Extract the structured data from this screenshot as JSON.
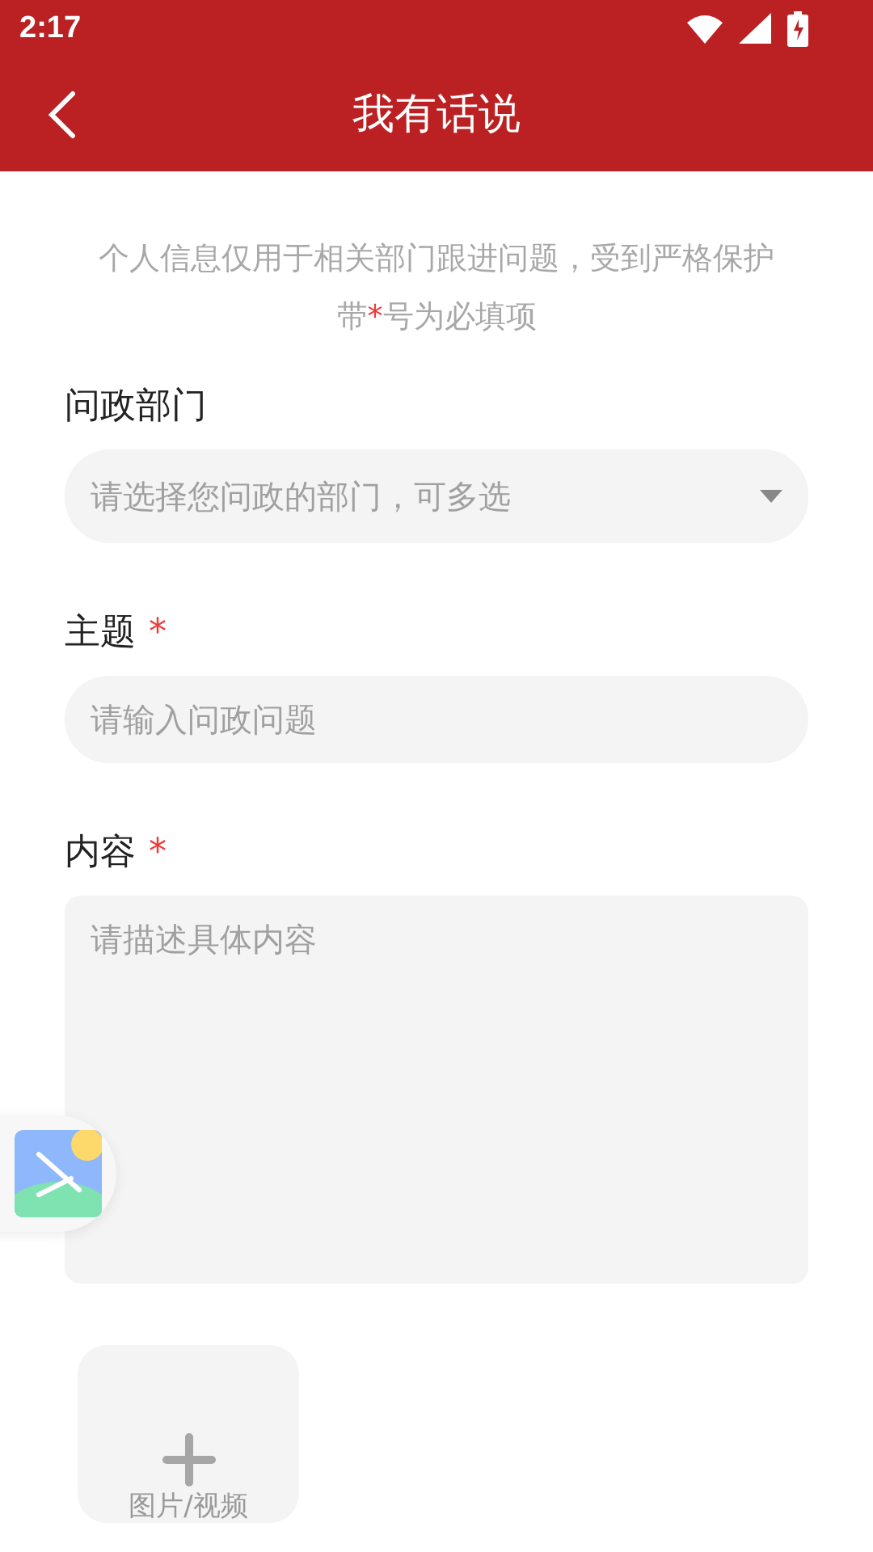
{
  "status_bar": {
    "time": "2:17"
  },
  "header": {
    "title": "我有话说"
  },
  "notice": {
    "text": "个人信息仅用于相关部门跟进问题，受到严格保护",
    "before": "带",
    "mark": "*",
    "after": "号为必填项"
  },
  "fields": [
    {
      "kind": "select",
      "label": "问政部门",
      "placeholder": "请选择您问政的部门，可多选"
    },
    {
      "kind": "input",
      "label": "主题",
      "mark": "*",
      "placeholder": "请输入问政问题"
    },
    {
      "kind": "textarea",
      "label": "内容",
      "mark": "*",
      "placeholder": "请描述具体内容"
    }
  ],
  "upload": {
    "label": "图片/视频"
  }
}
